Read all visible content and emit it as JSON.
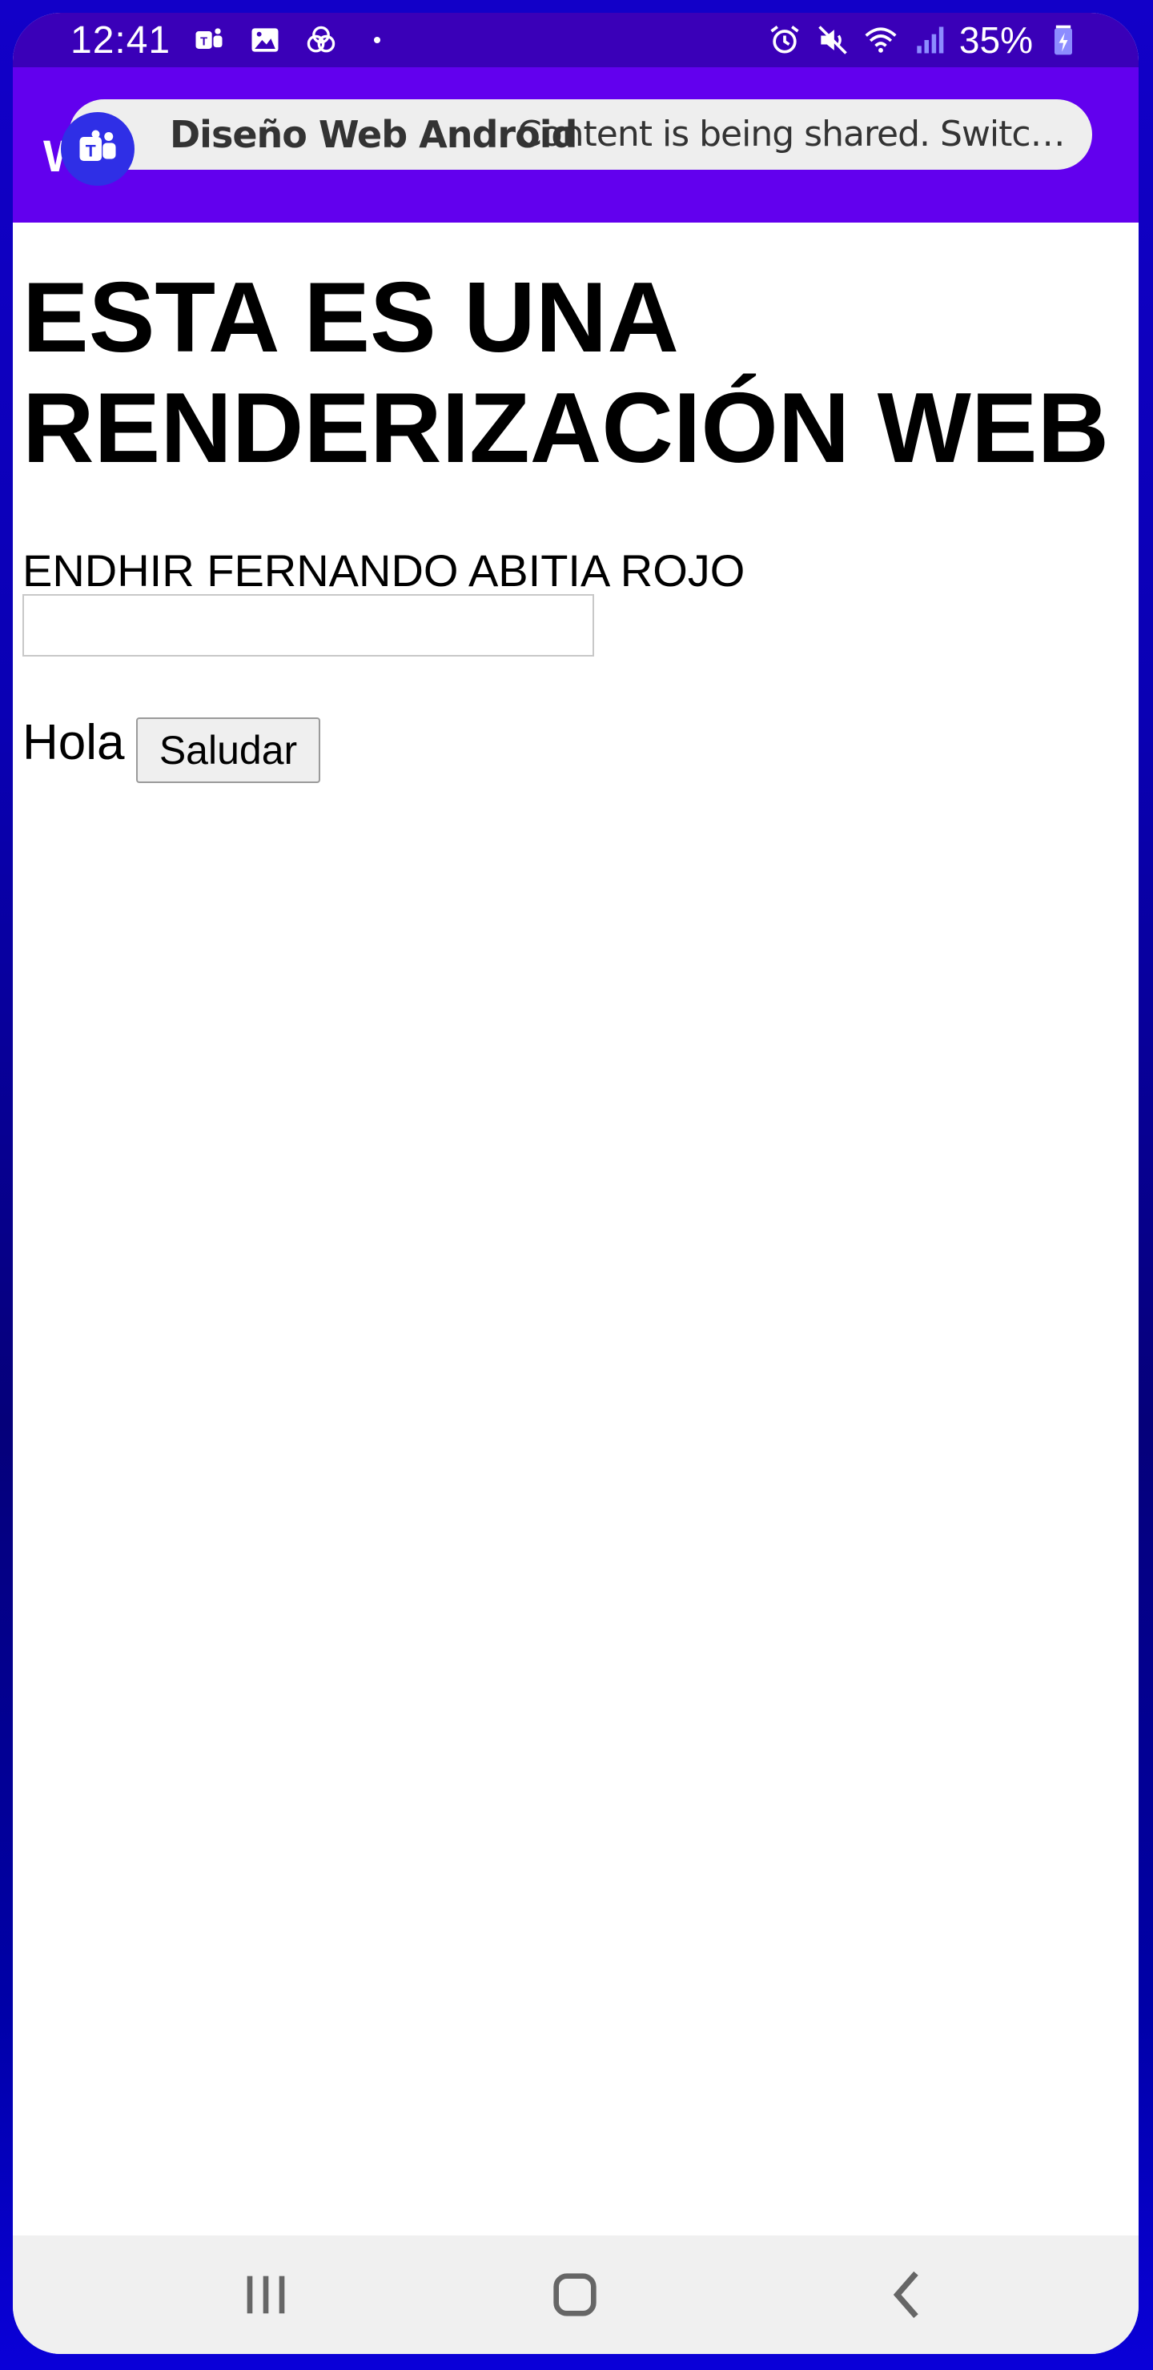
{
  "status_bar": {
    "time": "12:41",
    "battery": "35%",
    "left_icons": [
      "teams-icon",
      "image-icon",
      "venn-icon",
      "dot-icon"
    ],
    "right_icons": [
      "alarm-icon",
      "mute-icon",
      "wifi-icon",
      "signal-icon",
      "battery-icon"
    ]
  },
  "app_bar": {
    "title_partial": "W",
    "color": "#6200ee"
  },
  "share_banner": {
    "title": "Diseño Web Android",
    "message": "Content is being shared. Switch t…"
  },
  "web": {
    "heading": "ESTA ES UNA RENDERIZACIÓN WEB",
    "name_label": "ENDHIR FERNANDO ABITIA ROJO",
    "name_input_value": "",
    "greeting_text": "Hola",
    "greet_button_label": "Saludar"
  },
  "nav_bar": {
    "buttons": [
      "recents-icon",
      "home-icon",
      "back-icon"
    ]
  }
}
